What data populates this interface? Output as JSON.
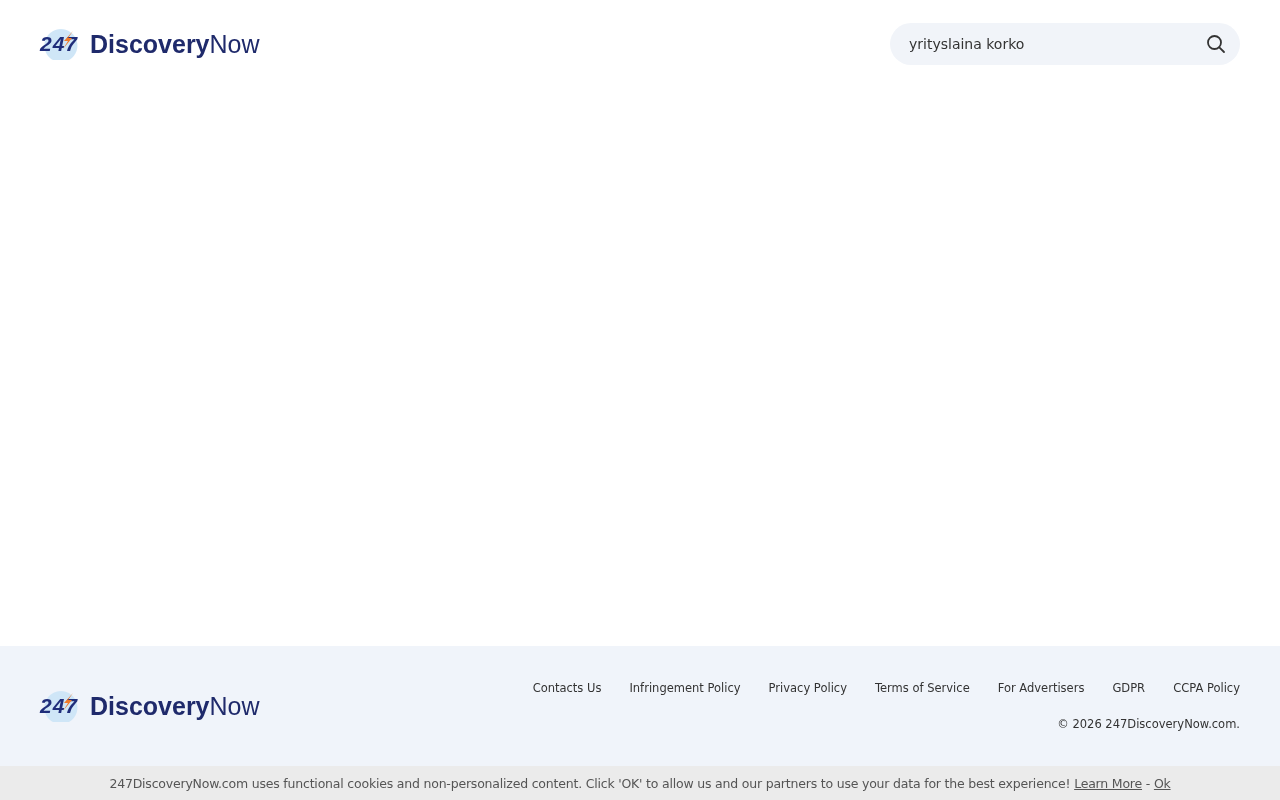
{
  "header": {
    "logo": {
      "number": "247",
      "brand_bold": "Discovery",
      "brand_light": "Now"
    },
    "search": {
      "value": "yrityslaina korko"
    }
  },
  "footer": {
    "logo": {
      "number": "247",
      "brand_bold": "Discovery",
      "brand_light": "Now"
    },
    "links": [
      "Contacts Us",
      "Infringement Policy",
      "Privacy Policy",
      "Terms of Service",
      "For Advertisers",
      "GDPR",
      "CCPA Policy"
    ],
    "copyright": "© 2026 247DiscoveryNow.com."
  },
  "cookie_bar": {
    "text": "247DiscoveryNow.com uses functional cookies and non-personalized content. Click 'OK' to allow us and our partners to use your data for the best experience!",
    "learn_more": "Learn More",
    "separator": "-",
    "ok": "Ok"
  }
}
